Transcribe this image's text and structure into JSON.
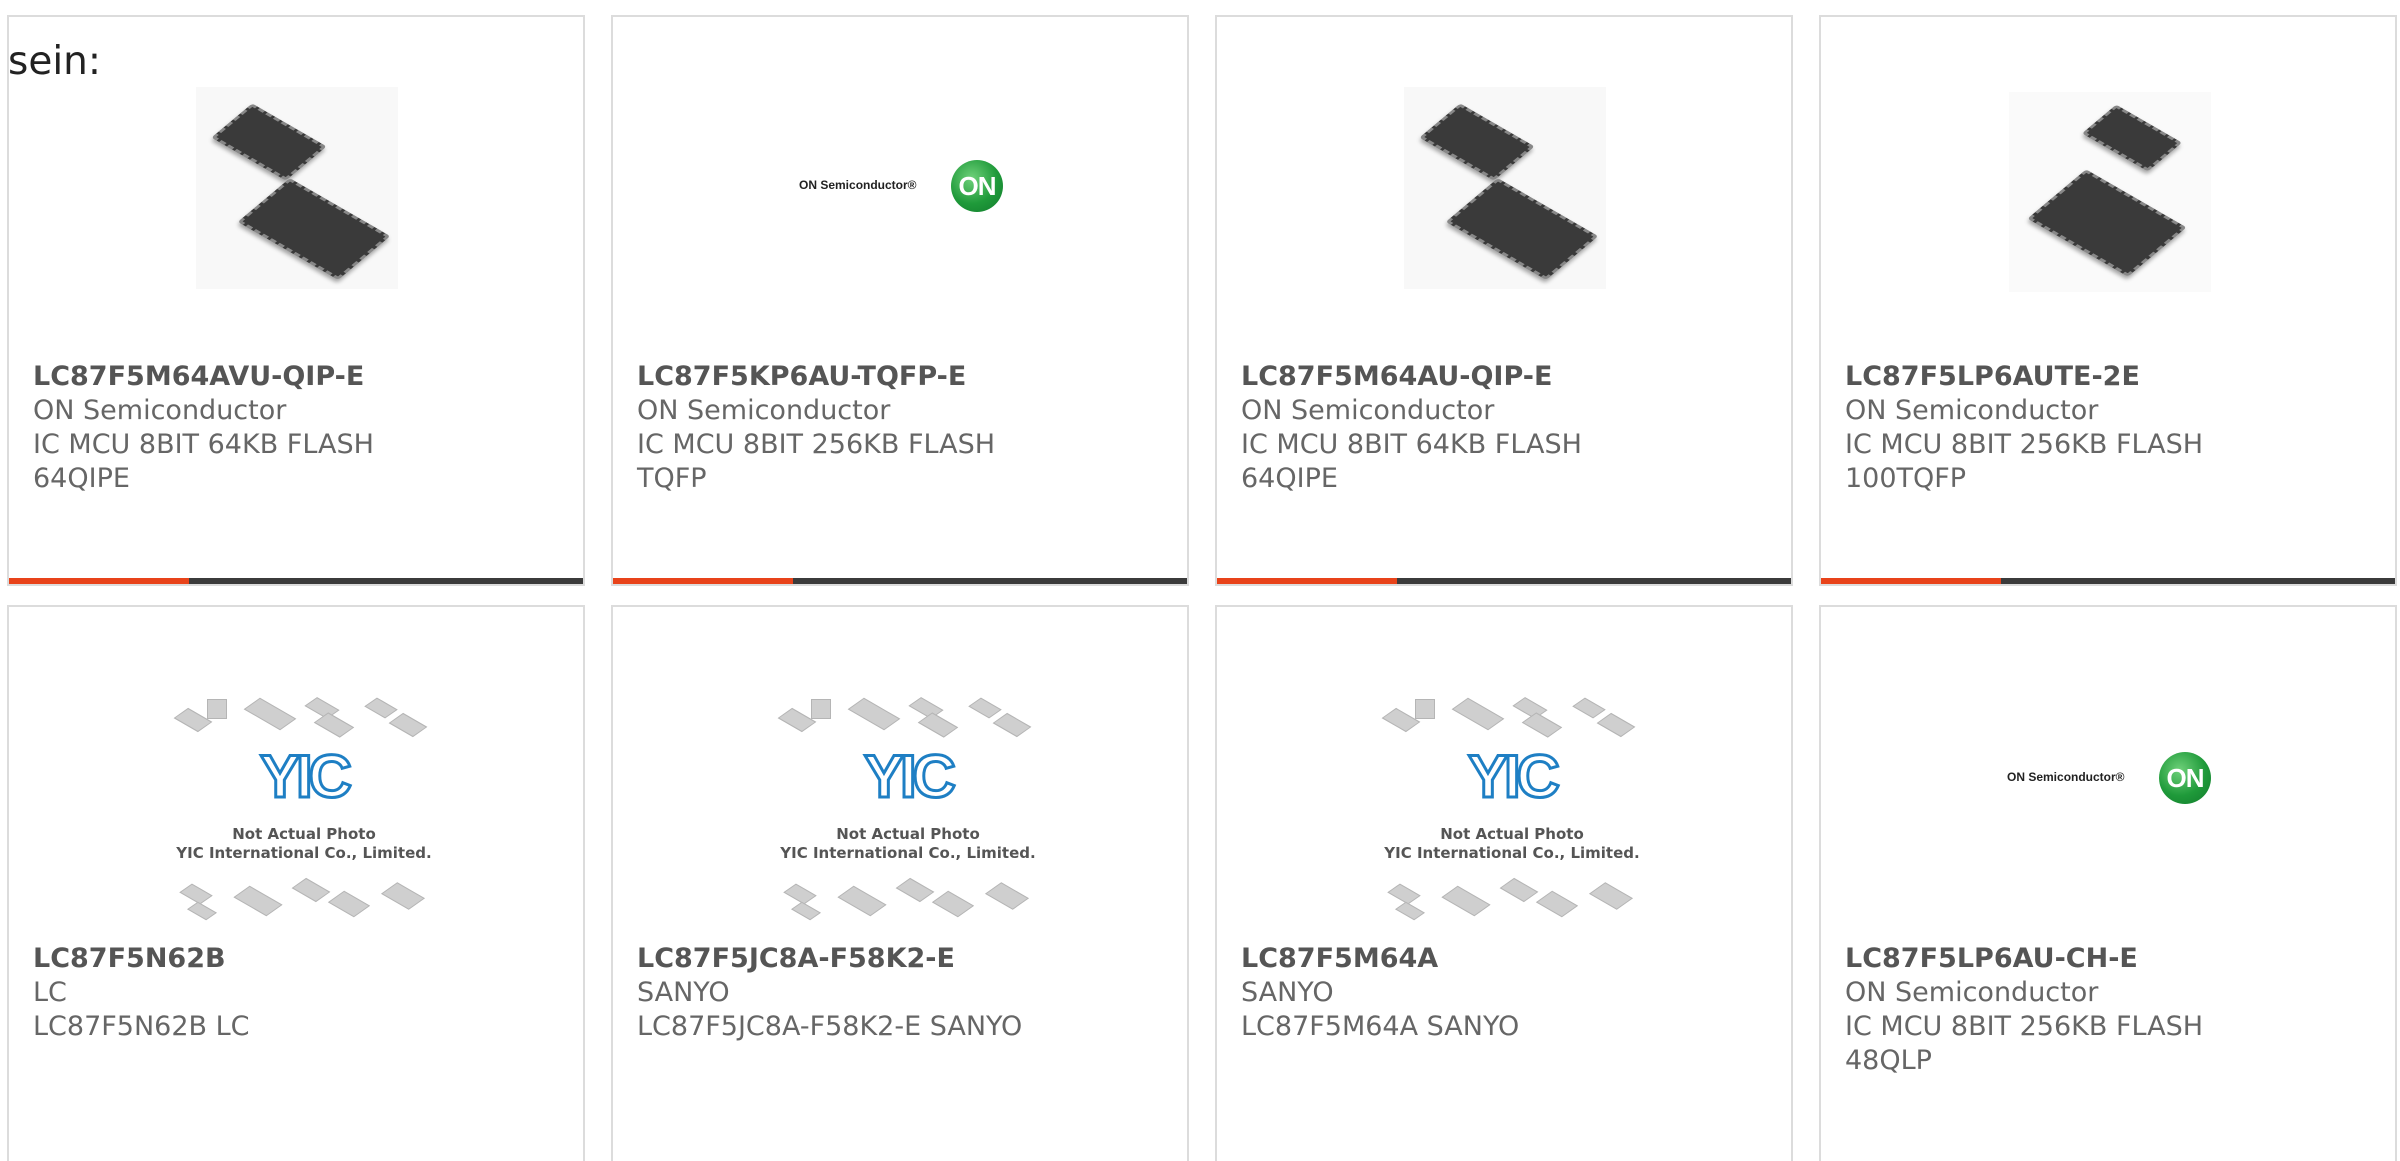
{
  "lead_text": "sein:",
  "accent_color": "#e8431a",
  "bar_color": "#3b3b3b",
  "products": [
    {
      "part": "LC87F5M64AVU-QIP-E",
      "manufacturer": "ON Semiconductor",
      "description": "IC MCU 8BIT 64KB FLASH 64QIPE",
      "image": "chip-photo"
    },
    {
      "part": "LC87F5KP6AU-TQFP-E",
      "manufacturer": "ON Semiconductor",
      "description": "IC MCU 8BIT 256KB FLASH TQFP",
      "image": "on-semiconductor-logo"
    },
    {
      "part": "LC87F5M64AU-QIP-E",
      "manufacturer": "ON Semiconductor",
      "description": "IC MCU 8BIT 64KB FLASH 64QIPE",
      "image": "chip-photo"
    },
    {
      "part": "LC87F5LP6AUTE-2E",
      "manufacturer": "ON Semiconductor",
      "description": "IC MCU 8BIT 256KB FLASH 100TQFP",
      "image": "chip-photo"
    },
    {
      "part": "LC87F5N62B",
      "manufacturer": "LC",
      "description": "LC87F5N62B LC",
      "image": "yic-placeholder"
    },
    {
      "part": "LC87F5JC8A-F58K2-E",
      "manufacturer": "SANYO",
      "description": "LC87F5JC8A-F58K2-E SANYO",
      "image": "yic-placeholder"
    },
    {
      "part": "LC87F5M64A",
      "manufacturer": "SANYO",
      "description": "LC87F5M64A SANYO",
      "image": "yic-placeholder"
    },
    {
      "part": "LC87F5LP6AU-CH-E",
      "manufacturer": "ON Semiconductor",
      "description": "IC MCU 8BIT 256KB FLASH 48QLP",
      "image": "on-semiconductor-logo"
    }
  ],
  "on_logo": {
    "wordmark": "ON Semiconductor®",
    "badge": "ON",
    "badge_color": "#1f9a3a"
  },
  "yic_placeholder": {
    "logo": "YIC",
    "caption_line1": "Not Actual Photo",
    "caption_line2": "YIC International Co., Limited.",
    "logo_color": "#1e7fc4"
  }
}
